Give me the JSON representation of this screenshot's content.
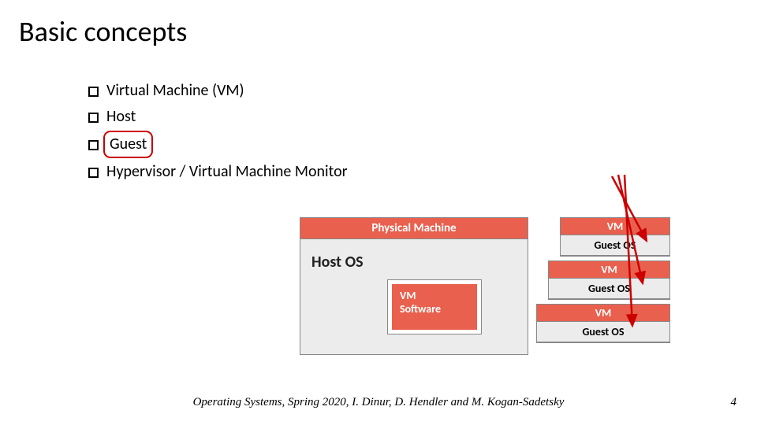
{
  "title": "Basic concepts",
  "bullets": {
    "b1": "Virtual Machine (VM)",
    "b2": "Host",
    "b3": "Guest",
    "b4": "Hypervisor  /  Virtual Machine Monitor"
  },
  "diagram": {
    "physical_header": "Physical Machine",
    "host_os_label": "Host OS",
    "vm_software_line1": "VM",
    "vm_software_line2": "Software",
    "vm_head": "VM",
    "guest_os": "Guest OS"
  },
  "footer": {
    "credit": "Operating Systems, Spring 2020, I. Dinur, D. Hendler and M. Kogan-Sadetsky",
    "page": "4"
  }
}
